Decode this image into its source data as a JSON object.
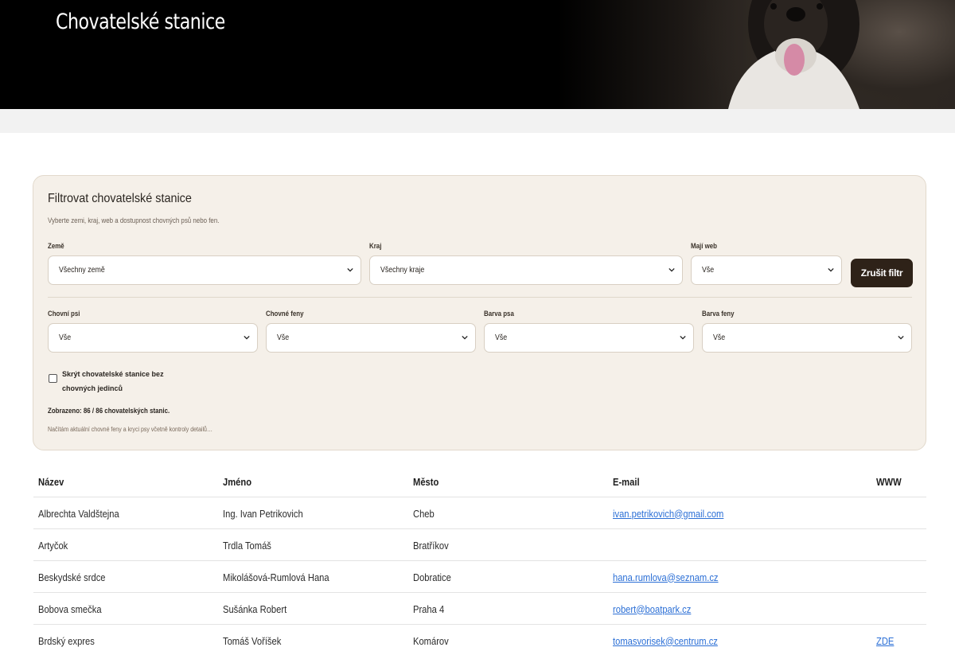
{
  "header": {
    "title": "Chovatelské stanice"
  },
  "filter": {
    "title": "Filtrovat chovatelské stanice",
    "subtitle": "Vyberte zemi, kraj, web a dostupnost chovných psů nebo fen.",
    "fields": {
      "country": {
        "label": "Země",
        "value": "Všechny země"
      },
      "region": {
        "label": "Kraj",
        "value": "Všechny kraje"
      },
      "web": {
        "label": "Mají web",
        "value": "Vše"
      },
      "males": {
        "label": "Chovní psi",
        "value": "Vše"
      },
      "females": {
        "label": "Chovné feny",
        "value": "Vše"
      },
      "dog_color": {
        "label": "Barva psa",
        "value": "Vše"
      },
      "bitch_color": {
        "label": "Barva feny",
        "value": "Vše"
      }
    },
    "clear_button": "Zrušit filtr",
    "hide_checkbox_label": "Skrýt chovatelské stanice bez chovných jedinců",
    "count_text": "Zobrazeno: 86 / 86 chovatelských stanic.",
    "loading_text": "Načítám aktuální chovné feny a kryci psy včetně kontroly detailů…"
  },
  "table": {
    "headers": [
      "Název",
      "Jméno",
      "Město",
      "E-mail",
      "WWW"
    ],
    "rows": [
      {
        "name": "Albrechta Valdštejna",
        "owner": "Ing. Ivan Petrikovich",
        "city": "Cheb",
        "email": "ivan.petrikovich@gmail.com",
        "www": ""
      },
      {
        "name": "Artyčok",
        "owner": "Trdla Tomáš",
        "city": "Bratříkov",
        "email": "",
        "www": ""
      },
      {
        "name": "Beskydské srdce",
        "owner": "Mikolášová-Rumlová Hana",
        "city": "Dobratice",
        "email": "hana.rumlova@seznam.cz",
        "www": ""
      },
      {
        "name": "Bobova smečka",
        "owner": "Sušánka Robert",
        "city": "Praha 4",
        "email": "robert@boatpark.cz",
        "www": ""
      },
      {
        "name": "Brdský expres",
        "owner": "Tomáš Voříšek",
        "city": "Komárov",
        "email": "tomasvorisek@centrum.cz",
        "www": "ZDE"
      }
    ]
  },
  "colors": {
    "panel_bg": "#f5f0e9",
    "button_bg": "#2e2218",
    "link": "#2b6fd6"
  }
}
